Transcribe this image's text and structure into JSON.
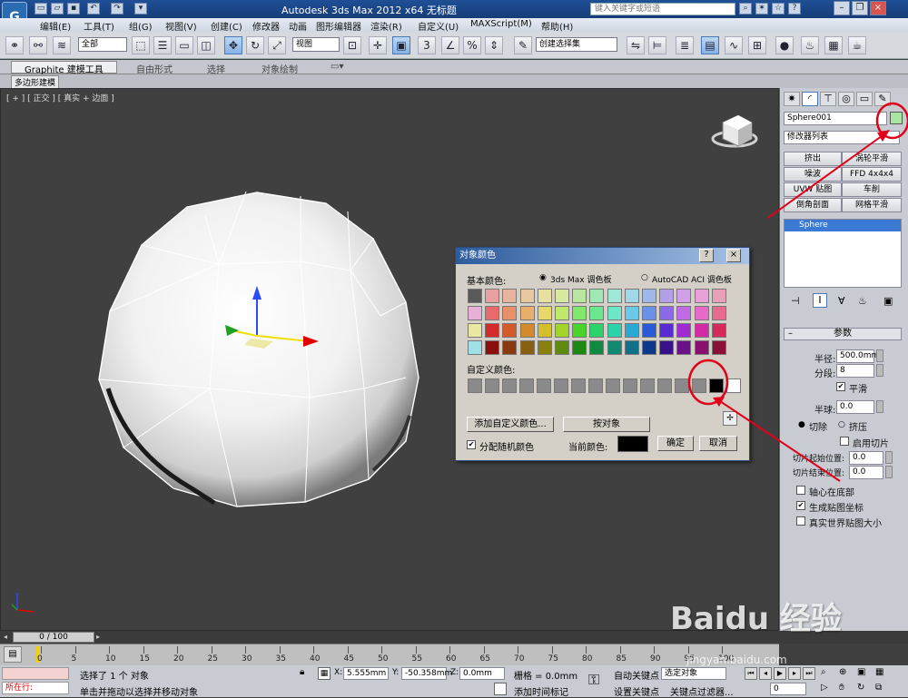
{
  "window": {
    "title": "Autodesk 3ds Max  2012 x64      无标题",
    "search_placeholder": "键入关键字或短语"
  },
  "menu": [
    "编辑(E)",
    "工具(T)",
    "组(G)",
    "视图(V)",
    "创建(C)",
    "修改器",
    "动画",
    "图形编辑器",
    "渲染(R)",
    "自定义(U)",
    "MAXScript(M)",
    "帮助(H)"
  ],
  "toolbar": {
    "selection_filter": "全部",
    "ref_coord": "视图",
    "named_selection": "创建选择集"
  },
  "ribbon": {
    "tabs": [
      "Graphite 建模工具",
      "自由形式",
      "选择",
      "对象绘制"
    ],
    "sub_label": "多边形建模"
  },
  "viewport": {
    "label": "[ + ] [ 正交 ] [ 真实 + 边面 ]"
  },
  "panel": {
    "object_name": "Sphere001",
    "object_color": "#a8e6a0",
    "modifier_list": "修改器列表",
    "modifier_buttons": [
      "挤出",
      "涡轮平滑",
      "噪波",
      "FFD 4x4x4",
      "UVW 贴图",
      "车削",
      "倒角剖面",
      "网格平滑"
    ],
    "stack_item": "Sphere",
    "rollout_title": "参数",
    "radius_label": "半径:",
    "radius_value": "500.0mm",
    "segments_label": "分段:",
    "segments_value": "8",
    "smooth_label": "平滑",
    "hemisphere_label": "半球:",
    "hemisphere_value": "0.0",
    "chop_label": "切除",
    "squash_label": "挤压",
    "slice_on_label": "启用切片",
    "slice_from_label": "切片起始位置:",
    "slice_from_value": "0.0",
    "slice_to_label": "切片结束位置:",
    "slice_to_value": "0.0",
    "base_pivot_label": "轴心在底部",
    "gen_map_label": "生成贴图坐标",
    "real_world_label": "真实世界贴图大小"
  },
  "dialog": {
    "title": "对象颜色",
    "help": "?",
    "close": "×",
    "basic_colors": "基本颜色:",
    "palette_max": "3ds Max 调色板",
    "palette_aci": "AutoCAD ACI 调色板",
    "custom_colors": "自定义颜色:",
    "add_custom": "添加自定义颜色...",
    "by_object": "按对象",
    "assign_random": "分配随机颜色",
    "current_color_label": "当前颜色:",
    "ok": "确定",
    "cancel": "取消",
    "colors": [
      [
        "#5a5a5a",
        "#e8a0a0",
        "#e8b4a0",
        "#e8c8a0",
        "#e8e0a0",
        "#d8e8a0",
        "#b8e8a0",
        "#a0e8b4",
        "#a0e8d8",
        "#a0d8e8",
        "#a0b8e8",
        "#b4a0e8",
        "#d0a0e8",
        "#e8a0d8",
        "#e8a0b8"
      ],
      [
        "#e8b0d8",
        "#e86a6a",
        "#e8906a",
        "#e8b06a",
        "#e8d86a",
        "#c0e86a",
        "#80e86a",
        "#6ae890",
        "#6ae8c8",
        "#6ac8e8",
        "#6a90e8",
        "#8a6ae8",
        "#c06ae8",
        "#e86ac8",
        "#e86a90"
      ],
      [
        "#e8e8a0",
        "#d42a2a",
        "#d45a2a",
        "#d48a2a",
        "#d4c02a",
        "#a0d42a",
        "#4ad42a",
        "#2ad46a",
        "#2ad4a8",
        "#2aa8d4",
        "#2a5ad4",
        "#5a2ad4",
        "#a02ad4",
        "#d42aa8",
        "#d42a5a"
      ],
      [
        "#a0e0e8",
        "#8a1010",
        "#8a3a10",
        "#8a6010",
        "#8a8010",
        "#608a10",
        "#1a8a10",
        "#108a40",
        "#108a70",
        "#10708a",
        "#10388a",
        "#38108a",
        "#6a108a",
        "#8a1070",
        "#8a1038"
      ]
    ],
    "custom_last": [
      "#000000",
      "#ffffff"
    ]
  },
  "timeline": {
    "frame_counter": "0 / 100",
    "ticks": [
      "0",
      "5",
      "10",
      "15",
      "20",
      "25",
      "30",
      "35",
      "40",
      "45",
      "50",
      "55",
      "60",
      "65",
      "70",
      "75",
      "80",
      "85",
      "90",
      "95",
      "100"
    ]
  },
  "status": {
    "selected": "选择了 1 个 对象",
    "prompt": "单击并拖动以选择并移动对象",
    "running": "所在行:",
    "x_label": "X:",
    "x": "5.555mm",
    "y_label": "Y:",
    "y": "-50.358mm",
    "z_label": "Z:",
    "z": "0.0mm",
    "grid": "栅格 = 0.0mm",
    "add_time_tag": "添加时间标记",
    "auto_key": "自动关键点",
    "set_key": "设置关键点",
    "key_filter_sel": "选定对象",
    "key_filters": "关键点过滤器...",
    "frame": "0"
  },
  "watermark": "Baidu 经验",
  "watermark_url": "jingyan.baidu.com"
}
